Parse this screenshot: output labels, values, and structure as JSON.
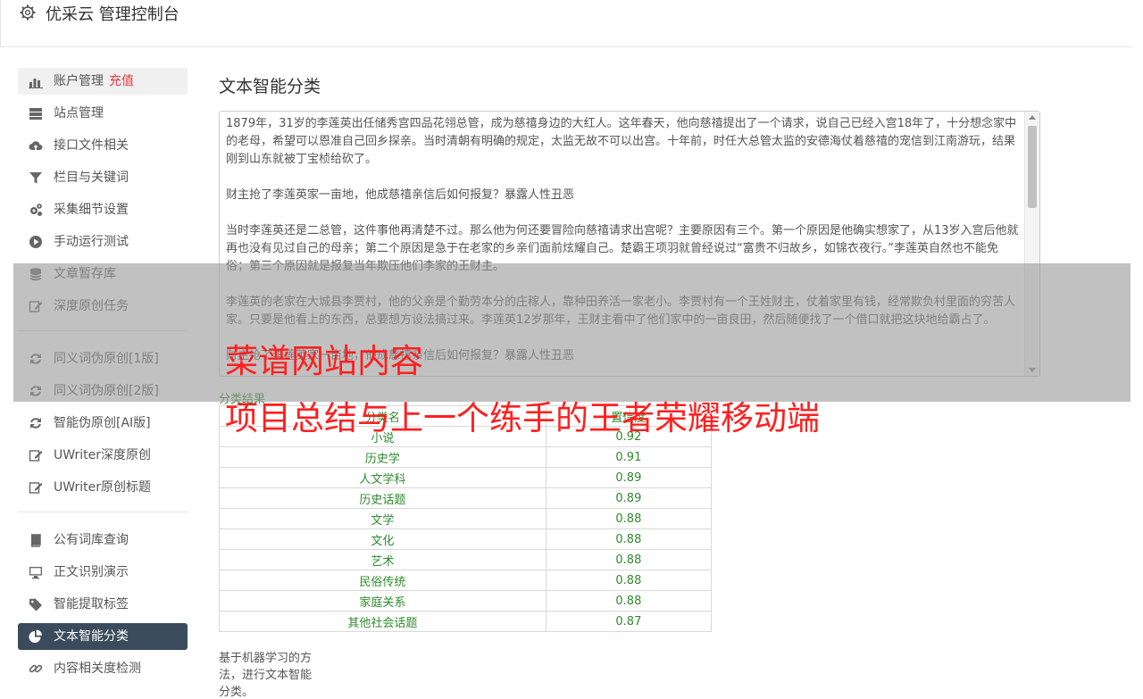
{
  "header": {
    "title": "优采云 管理控制台",
    "icon": "gear-icon"
  },
  "sidebar": {
    "groups": [
      [
        {
          "label": "账户管理",
          "badge": "充值",
          "icon": "bar-chart-icon"
        },
        {
          "label": "站点管理",
          "icon": "server-icon"
        },
        {
          "label": "接口文件相关",
          "icon": "cloud-upload-icon"
        },
        {
          "label": "栏目与关键词",
          "icon": "filter-icon"
        },
        {
          "label": "采集细节设置",
          "icon": "gears-icon"
        },
        {
          "label": "手动运行测试",
          "icon": "play-circle-icon"
        },
        {
          "label": "文章暂存库",
          "icon": "database-icon"
        },
        {
          "label": "深度原创任务",
          "icon": "edit-icon"
        }
      ],
      [
        {
          "label": "同义词伪原创[1版]",
          "icon": "refresh-icon"
        },
        {
          "label": "同义词伪原创[2版]",
          "icon": "refresh-icon"
        },
        {
          "label": "智能伪原创[AI版]",
          "icon": "refresh-icon"
        },
        {
          "label": "UWriter深度原创",
          "icon": "edit-icon"
        },
        {
          "label": "UWriter原创标题",
          "icon": "edit-icon"
        }
      ],
      [
        {
          "label": "公有词库查询",
          "icon": "book-icon"
        },
        {
          "label": "正文识别演示",
          "icon": "monitor-icon"
        },
        {
          "label": "智能提取标签",
          "icon": "tag-icon"
        },
        {
          "label": "文本智能分类",
          "icon": "pie-chart-icon",
          "active": true
        },
        {
          "label": "内容相关度检测",
          "icon": "link-icon"
        }
      ]
    ]
  },
  "main": {
    "title": "文本智能分类",
    "paragraphs": [
      "1879年，31岁的李莲英出任储秀宫四品花翎总管，成为慈禧身边的大红人。这年春天，他向慈禧提出了一个请求，说自己已经入宫18年了，十分想念家中的老母，希望可以恩准自己回乡探亲。当时清朝有明确的规定，太监无故不可以出宫。十年前，时任大总管太监的安德海仗着慈禧的宠信到江南游玩，结果刚到山东就被丁宝桢给砍了。",
      "财主抢了李莲英家一亩地，他成慈禧亲信后如何报复？暴露人性丑恶",
      "当时李莲英还是二总管，这件事他再清楚不过。那么他为何还要冒险向慈禧请求出宫呢？主要原因有三个。第一个原因是他确实想家了，从13岁入宫后他就再也没有见过自己的母亲；第二个原因是急于在老家的乡亲们面前炫耀自己。楚霸王项羽就曾经说过“富贵不归故乡，如锦衣夜行。”李莲英自然也不能免俗；第三个原因就是报复当年欺压他们李家的王财主。",
      "李莲英的老家在大城县李贾村，他的父亲是个勤劳本分的庄稼人，靠种田养活一家老小。李贾村有一个王姓财主，仗着家里有钱，经常欺负村里面的穷苦人家。只要是他看上的东西，总要想方设法搞过来。李莲英12岁那年，王财主看中了他们家中的一亩良田，然后随便找了一个借口就把这块地给霸占了。",
      "财主抢了李莲英家一亩地，他成慈禧亲信后如何报复？暴露人性丑恶"
    ],
    "result_label": "分类结果",
    "table_headers": [
      "分类名",
      "置信度"
    ],
    "results": [
      [
        "小说",
        "0.92"
      ],
      [
        "历史学",
        "0.91"
      ],
      [
        "人文学科",
        "0.89"
      ],
      [
        "历史话题",
        "0.89"
      ],
      [
        "文学",
        "0.88"
      ],
      [
        "文化",
        "0.88"
      ],
      [
        "艺术",
        "0.88"
      ],
      [
        "民俗传统",
        "0.88"
      ],
      [
        "家庭关系",
        "0.88"
      ],
      [
        "其他社会话题",
        "0.87"
      ]
    ],
    "footnote": "基于机器学习的方法，进行文本智能分类。"
  },
  "watermark": {
    "line1": "菜谱网站内容",
    "line2": "项目总结与上一个练手的王者荣耀移动端"
  },
  "colors": {
    "accent_active": "#3a4b5c",
    "badge": "#e4393c",
    "result_text": "#2e8b2e",
    "watermark": "#ff1f1f"
  }
}
